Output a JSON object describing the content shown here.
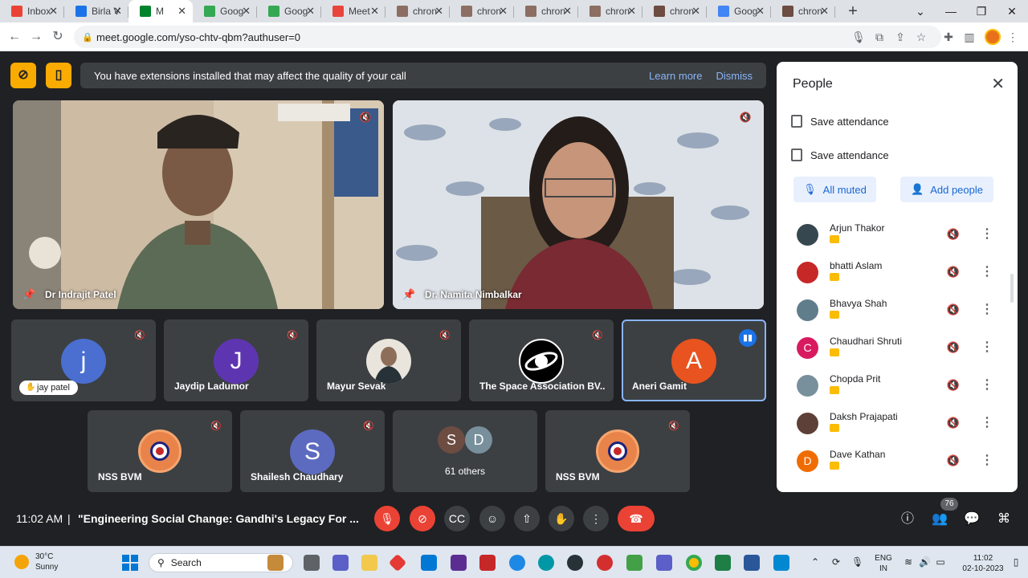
{
  "browser": {
    "tabs": [
      {
        "label": "Inbox",
        "color": "#ea4335",
        "active": false
      },
      {
        "label": "Birla V",
        "color": "#1a73e8",
        "active": false
      },
      {
        "label": "M",
        "color": "#00832d",
        "active": true
      },
      {
        "label": "Goog",
        "color": "#34a853",
        "active": false
      },
      {
        "label": "Goog",
        "color": "#34a853",
        "active": false
      },
      {
        "label": "Meet",
        "color": "#e8453c",
        "active": false
      },
      {
        "label": "chron",
        "color": "#8d6e63",
        "active": false
      },
      {
        "label": "chron",
        "color": "#8d6e63",
        "active": false
      },
      {
        "label": "chron",
        "color": "#8d6e63",
        "active": false
      },
      {
        "label": "chron",
        "color": "#8d6e63",
        "active": false
      },
      {
        "label": "chron",
        "color": "#6d4c41",
        "active": false
      },
      {
        "label": "Goog",
        "color": "#4285f4",
        "active": false
      },
      {
        "label": "chron",
        "color": "#6d4c41",
        "active": false
      }
    ],
    "url": "meet.google.com/yso-chtv-qbm?authuser=0"
  },
  "banner": {
    "message": "You have extensions installed that may affect the quality of your call",
    "learn_more": "Learn more",
    "dismiss": "Dismiss"
  },
  "main_tiles": [
    {
      "name": "Dr Indrajit Patel"
    },
    {
      "name": "Dr. Namita Nimbalkar"
    }
  ],
  "row1": [
    {
      "name": "jay patel",
      "initial": "j",
      "color": "#4a6fd1",
      "type": "hand"
    },
    {
      "name": "Jaydip Ladumor",
      "initial": "J",
      "color": "#5e35b1",
      "type": "avatar"
    },
    {
      "name": "Mayur Sevak",
      "initial": "",
      "color": "#8d6e63",
      "type": "photo"
    },
    {
      "name": "The Space Association BV...",
      "initial": "",
      "color": "#000000",
      "type": "logo"
    },
    {
      "name": "Aneri Gamit",
      "initial": "A",
      "color": "#e8531f",
      "type": "speaking"
    }
  ],
  "row2": [
    {
      "name": "NSS BVM",
      "type": "nss"
    },
    {
      "name": "Shailesh Chaudhary",
      "initial": "S",
      "color": "#5c6bc0",
      "type": "avatar"
    },
    {
      "name": "61 others",
      "type": "others",
      "initials": [
        "S",
        "D"
      ]
    },
    {
      "name": "NSS BVM",
      "type": "nss"
    }
  ],
  "controls": {
    "time": "11:02 AM",
    "separator": "|",
    "meeting_title": "\"Engineering Social Change: Gandhi's Legacy For ...",
    "participant_count": "76"
  },
  "panel": {
    "title": "People",
    "save_attendance_1": "Save attendance",
    "save_attendance_2": "Save attendance",
    "all_muted": "All muted",
    "add_people": "Add people",
    "people": [
      {
        "name": "Arjun Thakor",
        "initial": "",
        "color": "#37474f"
      },
      {
        "name": "bhatti Aslam",
        "initial": "",
        "color": "#c62828"
      },
      {
        "name": "Bhavya Shah",
        "initial": "",
        "color": "#607d8b"
      },
      {
        "name": "Chaudhari Shruti",
        "initial": "C",
        "color": "#d81b60"
      },
      {
        "name": "Chopda Prit",
        "initial": "",
        "color": "#78909c"
      },
      {
        "name": "Daksh Prajapati",
        "initial": "",
        "color": "#5d4037"
      },
      {
        "name": "Dave Kathan",
        "initial": "D",
        "color": "#ef6c00"
      }
    ]
  },
  "taskbar": {
    "temperature": "30°C",
    "condition": "Sunny",
    "search_placeholder": "Search",
    "lang_top": "ENG",
    "lang_bottom": "IN",
    "time": "11:02",
    "date": "02-10-2023"
  }
}
